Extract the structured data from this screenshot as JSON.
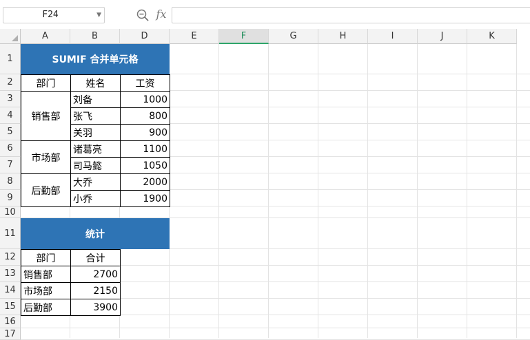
{
  "namebox": {
    "value": "F24"
  },
  "formula": {
    "value": ""
  },
  "icons": {
    "zoom": "zoom-icon",
    "fx": "fx"
  },
  "columns": [
    "A",
    "B",
    "D",
    "E",
    "F",
    "G",
    "H",
    "I",
    "J",
    "K"
  ],
  "selected_column": "F",
  "rows": [
    "1",
    "2",
    "3",
    "4",
    "5",
    "6",
    "7",
    "8",
    "9",
    "10",
    "11",
    "12",
    "13",
    "14",
    "15",
    "16",
    "17"
  ],
  "table1": {
    "title": "SUMIF 合并单元格",
    "headers": [
      "部门",
      "姓名",
      "工资"
    ],
    "groups": [
      {
        "dept": "销售部",
        "rows": [
          {
            "name": "刘备",
            "salary": "1000"
          },
          {
            "name": "张飞",
            "salary": "800"
          },
          {
            "name": "关羽",
            "salary": "900"
          }
        ]
      },
      {
        "dept": "市场部",
        "rows": [
          {
            "name": "诸葛亮",
            "salary": "1100"
          },
          {
            "name": "司马懿",
            "salary": "1050"
          }
        ]
      },
      {
        "dept": "后勤部",
        "rows": [
          {
            "name": "大乔",
            "salary": "2000"
          },
          {
            "name": "小乔",
            "salary": "1900"
          }
        ]
      }
    ]
  },
  "table2": {
    "title": "统计",
    "headers": [
      "部门",
      "合计"
    ],
    "rows": [
      {
        "dept": "销售部",
        "total": "2700"
      },
      {
        "dept": "市场部",
        "total": "2150"
      },
      {
        "dept": "后勤部",
        "total": "3900"
      }
    ]
  },
  "colors": {
    "title_bg": "#2e74b5",
    "title_fg": "#ffffff",
    "selected_accent": "#2ea56a"
  }
}
